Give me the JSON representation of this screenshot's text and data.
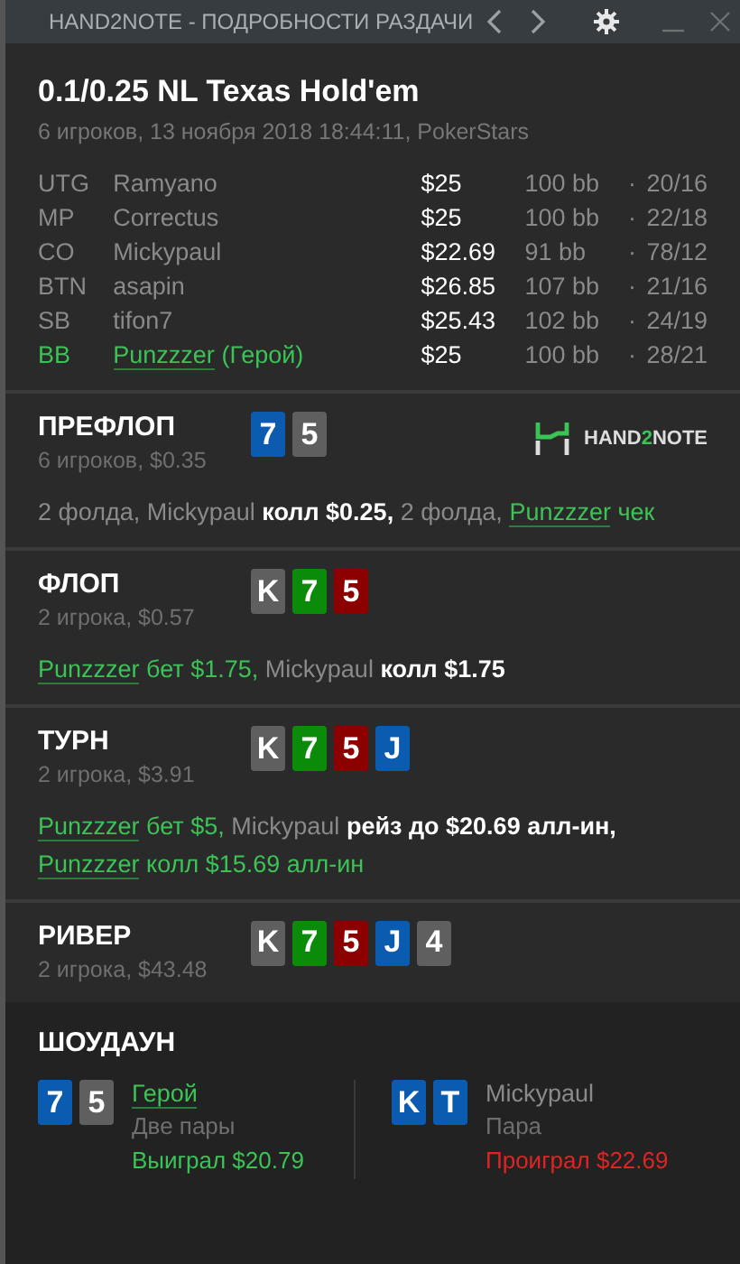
{
  "window": {
    "title": "HAND2NOTE - ПОДРОБНОСТИ РАЗДАЧИ"
  },
  "hand": {
    "title": "0.1/0.25 NL Texas Hold'em",
    "subtitle": "6 игроков, 13 ноября 2018 18:44:11, PokerStars"
  },
  "seats": [
    {
      "position": "UTG",
      "name": "Ramyano",
      "hero": false,
      "stack": "$25",
      "bb": "100 bb",
      "sep": "·",
      "stats": "20/16"
    },
    {
      "position": "MP",
      "name": "Correctus",
      "hero": false,
      "stack": "$25",
      "bb": "100 bb",
      "sep": "·",
      "stats": "22/18"
    },
    {
      "position": "CO",
      "name": "Mickypaul",
      "hero": false,
      "stack": "$22.69",
      "bb": "91 bb",
      "sep": "·",
      "stats": "78/12"
    },
    {
      "position": "BTN",
      "name": "asapin",
      "hero": false,
      "stack": "$26.85",
      "bb": "107 bb",
      "sep": "·",
      "stats": "21/16"
    },
    {
      "position": "SB",
      "name": "tifon7",
      "hero": false,
      "stack": "$25.43",
      "bb": "102 bb",
      "sep": "·",
      "stats": "24/19"
    },
    {
      "position": "BB",
      "name": "Punzzzer",
      "hero": true,
      "hero_tag": "(Герой)",
      "stack": "$25",
      "bb": "100 bb",
      "sep": "·",
      "stats": "28/21"
    }
  ],
  "streets": [
    {
      "name": "ПРЕФЛОП",
      "info": "6 игроков, $0.35",
      "cards": [
        {
          "rank": "7",
          "color": "#0b5bb0"
        },
        {
          "rank": "5",
          "color": "#5f5f5f"
        }
      ],
      "logo": {
        "parts": [
          {
            "text": "HAND",
            "kind": "plain"
          },
          {
            "text": "2",
            "kind": "accent"
          },
          {
            "text": "NOTE",
            "kind": "plain"
          }
        ]
      },
      "actions": [
        {
          "text": "2 фолда, Mickypaul",
          "kind": "plain"
        },
        {
          "text": "колл $0.25,",
          "kind": "act"
        },
        {
          "text": "2 фолда,",
          "kind": "plain"
        },
        {
          "text": "Punzzzer",
          "kind": "hero"
        },
        {
          "text": "чек",
          "kind": "hero_act"
        }
      ]
    },
    {
      "name": "ФЛОП",
      "info": "2 игрока, $0.57",
      "cards": [
        {
          "rank": "K",
          "color": "#5f5f5f"
        },
        {
          "rank": "7",
          "color": "#0a8c0a"
        },
        {
          "rank": "5",
          "color": "#8c0000"
        }
      ],
      "actions": [
        {
          "text": "Punzzzer",
          "kind": "hero"
        },
        {
          "text": "бет $1.75,",
          "kind": "hero_act"
        },
        {
          "text": "Mickypaul",
          "kind": "plain"
        },
        {
          "text": "колл $1.75",
          "kind": "act"
        }
      ]
    },
    {
      "name": "ТУРН",
      "info": "2 игрока, $3.91",
      "cards": [
        {
          "rank": "K",
          "color": "#5f5f5f"
        },
        {
          "rank": "7",
          "color": "#0a8c0a"
        },
        {
          "rank": "5",
          "color": "#8c0000"
        },
        {
          "rank": "J",
          "color": "#0b5bb0"
        }
      ],
      "actions": [
        {
          "text": "Punzzzer",
          "kind": "hero"
        },
        {
          "text": "бет $5,",
          "kind": "hero_act"
        },
        {
          "text": "Mickypaul",
          "kind": "plain"
        },
        {
          "text": "рейз до $20.69 алл-ин,",
          "kind": "act"
        },
        {
          "text": "Punzzzer",
          "kind": "hero"
        },
        {
          "text": "колл $15.69 алл-ин",
          "kind": "hero_act"
        }
      ]
    },
    {
      "name": "РИВЕР",
      "info": "2 игрока, $43.48",
      "cards": [
        {
          "rank": "K",
          "color": "#5f5f5f"
        },
        {
          "rank": "7",
          "color": "#0a8c0a"
        },
        {
          "rank": "5",
          "color": "#8c0000"
        },
        {
          "rank": "J",
          "color": "#0b5bb0"
        },
        {
          "rank": "4",
          "color": "#5f5f5f"
        }
      ]
    }
  ],
  "showdown": {
    "title": "ШОУДАУН",
    "players": [
      {
        "cards": [
          {
            "rank": "7",
            "color": "#0b5bb0"
          },
          {
            "rank": "5",
            "color": "#5f5f5f"
          }
        ],
        "name": "Герой",
        "hero": true,
        "hand": "Две пары",
        "result": "Выиграл $20.79",
        "won": true
      },
      {
        "cards": [
          {
            "rank": "K",
            "color": "#0b5bb0"
          },
          {
            "rank": "T",
            "color": "#0b5bb0"
          }
        ],
        "name": "Mickypaul",
        "hero": false,
        "hand": "Пара",
        "result": "Проиграл $22.69",
        "won": false
      }
    ]
  }
}
